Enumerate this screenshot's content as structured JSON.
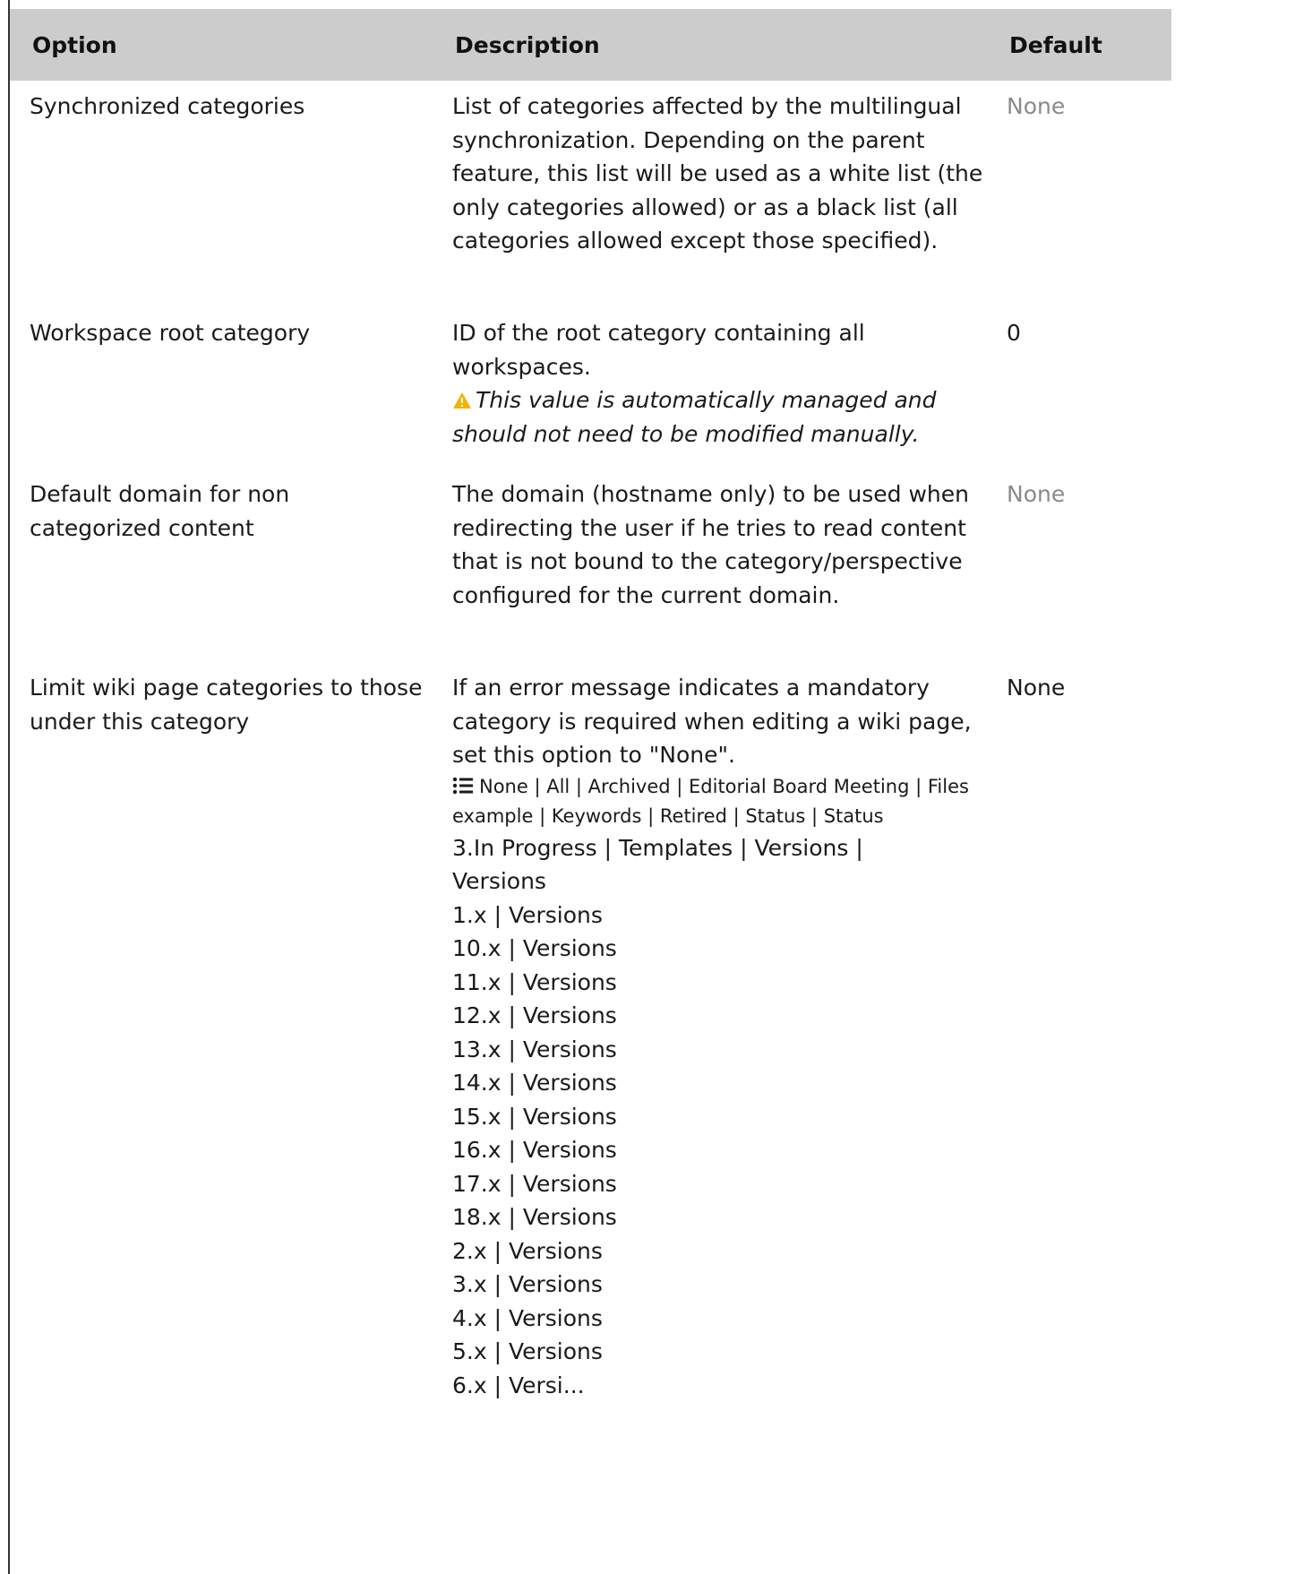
{
  "table": {
    "headers": {
      "option": "Option",
      "description": "Description",
      "default": "Default"
    },
    "rows": [
      {
        "option": "Synchronized categories",
        "description": "List of categories affected by the multilingual synchronization. Depending on the parent feature, this list will be used as a white list (the only categories allowed) or as a black list (all categories allowed except those specified).",
        "default": "None"
      },
      {
        "option": "Workspace root category",
        "description": "ID of the root category containing all workspaces.",
        "warning": "This value is automatically managed and should not need to be modified manually.",
        "default": "0"
      },
      {
        "option": "Default domain for non categorized content",
        "description": "The domain (hostname only) to be used when redirecting the user if he tries to read content that is not bound to the category/perspective configured for the current domain.",
        "default": "None"
      },
      {
        "option": "Limit wiki page categories to those under this category",
        "description": "If an error message indicates a mandatory category is required when editing a wiki page, set this option to \"None\".",
        "category_list_small": "None | All | Archived | Editorial Board Meeting | Files example | Keywords | Retired | Status | Status",
        "category_list_lines": [
          "3.In Progress | Templates | Versions |",
          "Versions",
          "1.x | Versions",
          "10.x | Versions",
          "11.x | Versions",
          "12.x | Versions",
          "13.x | Versions",
          "14.x | Versions",
          "15.x | Versions",
          "16.x | Versions",
          "17.x | Versions",
          "18.x | Versions",
          "2.x | Versions",
          "3.x | Versions",
          "4.x | Versions",
          "5.x | Versions",
          "6.x | Versi..."
        ],
        "default": "None"
      }
    ]
  },
  "icons": {
    "warning": "warning-triangle-icon",
    "list": "list-icon"
  },
  "colors": {
    "header_bg": "#cccccc",
    "muted_text": "#8a8a8a",
    "warning": "#f0b400"
  }
}
